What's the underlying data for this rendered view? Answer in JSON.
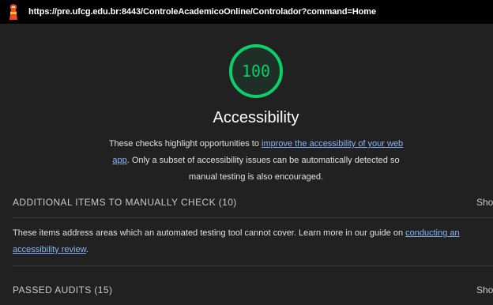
{
  "browser": {
    "url": "https://pre.ufcg.edu.br:8443/ControleAcademicoOnline/Controlador?command=Home"
  },
  "gauge": {
    "score": "100",
    "score_fraction": 1.0,
    "color": "#0cce6b"
  },
  "category": {
    "title": "Accessibility",
    "desc_part1": "These checks highlight opportunities to ",
    "desc_link": "improve the accessibility of your web app",
    "desc_part2": ". Only a subset of accessibility issues can be automatically detected so manual testing is also encouraged."
  },
  "manual": {
    "header": "ADDITIONAL ITEMS TO MANUALLY CHECK (10)",
    "toggle": "Sho",
    "desc_part1": "These items address areas which an automated testing tool cannot cover. Learn more in our guide on ",
    "desc_link": "conducting an accessibility review",
    "desc_part2": "."
  },
  "passed": {
    "header": "PASSED AUDITS (15)",
    "toggle": "Sho"
  },
  "colors": {
    "background": "#212121",
    "link": "#8ab4f8",
    "pass_green": "#0cce6b"
  }
}
